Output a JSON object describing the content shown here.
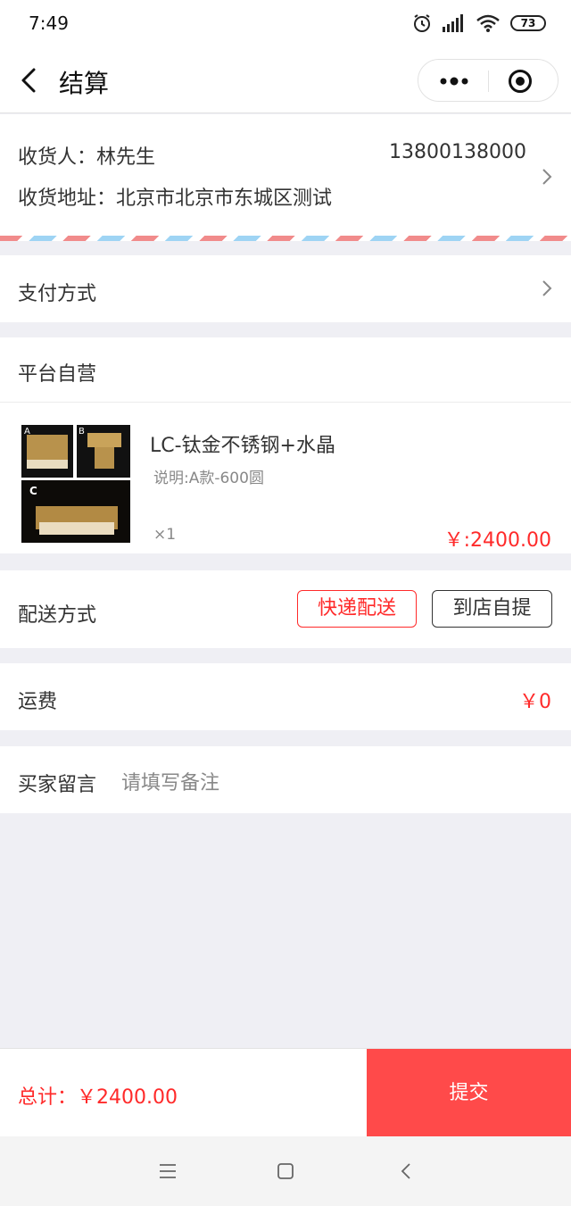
{
  "status_bar": {
    "time": "7:49",
    "battery": "73",
    "icons": [
      "alarm-icon",
      "signal-icon",
      "wifi-icon",
      "battery-icon"
    ]
  },
  "nav": {
    "title": "结算",
    "more_icon": "more-dots-icon",
    "capsule_icon": "target-icon"
  },
  "address": {
    "name": "收货人：林先生",
    "phone": "13800138000",
    "line": "收货地址：北京市北京市东城区测试"
  },
  "payment": {
    "label": "支付方式"
  },
  "shop": {
    "label": "平台自营"
  },
  "product": {
    "name": "LC-钛金不锈钢+水晶",
    "spec": "说明:A款-600圆",
    "qty": "×1",
    "price": "￥:2400.00",
    "thumb_labels": [
      "A",
      "B",
      "C"
    ]
  },
  "delivery": {
    "label": "配送方式",
    "options": [
      "快递配送",
      "到店自提"
    ],
    "selected": "快递配送"
  },
  "freight": {
    "label": "运费",
    "value": "￥0"
  },
  "message": {
    "label": "买家留言",
    "placeholder": "请填写备注"
  },
  "footer": {
    "total": "总计：￥2400.00",
    "submit": "提交"
  },
  "colors": {
    "accent": "#ff2a2a",
    "submit_bg": "#ff4a4a",
    "page_bg": "#efeff4"
  }
}
